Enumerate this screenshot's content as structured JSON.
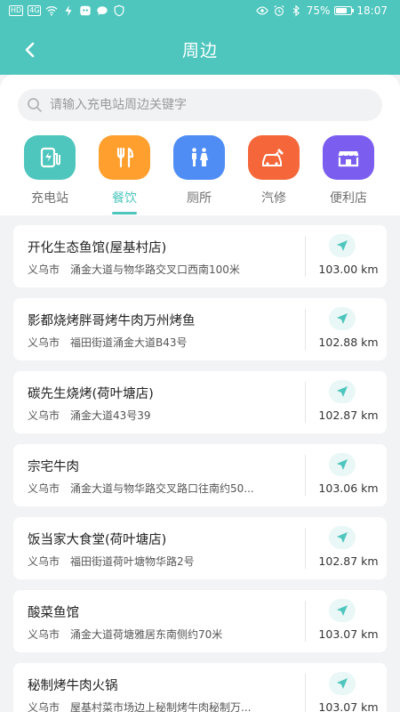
{
  "status_bar": {
    "hd": "HD",
    "net": "4G",
    "battery_pct": "75%",
    "battery_level": 0.75,
    "time": "18:07"
  },
  "header": {
    "title": "周边",
    "back_icon": "chevron-left-icon"
  },
  "search": {
    "placeholder": "请输入充电站周边关键字",
    "value": ""
  },
  "colors": {
    "brand": "#4ec6bd",
    "charging": "#4ec6bd",
    "food": "#ff9f2e",
    "toilet": "#4f8df5",
    "repair": "#f5673a",
    "store": "#7b5ef0"
  },
  "categories": [
    {
      "label": "充电站",
      "icon": "charging-station-icon",
      "color": "#4ec6bd",
      "active": false
    },
    {
      "label": "餐饮",
      "icon": "fork-knife-icon",
      "color": "#ff9f2e",
      "active": true
    },
    {
      "label": "厕所",
      "icon": "toilet-icon",
      "color": "#4f8df5",
      "active": false
    },
    {
      "label": "汽修",
      "icon": "car-repair-icon",
      "color": "#f5673a",
      "active": false
    },
    {
      "label": "便利店",
      "icon": "store-icon",
      "color": "#7b5ef0",
      "active": false
    }
  ],
  "places": [
    {
      "name": "开化生态鱼馆(屋基村店)",
      "city": "义乌市",
      "address": "涌金大道与物华路交叉口西南100米",
      "distance": "103.00 km"
    },
    {
      "name": "影都烧烤胖哥烤牛肉万州烤鱼",
      "city": "义乌市",
      "address": "福田街道涌金大道B43号",
      "distance": "102.88 km"
    },
    {
      "name": "碳先生烧烤(荷叶塘店)",
      "city": "义乌市",
      "address": "涌金大道43号39",
      "distance": "102.87 km"
    },
    {
      "name": "宗宅牛肉",
      "city": "义乌市",
      "address": "涌金大道与物华路交叉路口往南约50...",
      "distance": "103.06 km"
    },
    {
      "name": "饭当家大食堂(荷叶塘店)",
      "city": "义乌市",
      "address": "福田街道荷叶塘物华路2号",
      "distance": "102.87 km"
    },
    {
      "name": "酸菜鱼馆",
      "city": "义乌市",
      "address": "涌金大道荷塘雅居东南侧约70米",
      "distance": "103.07 km"
    },
    {
      "name": "秘制烤牛肉火锅",
      "city": "义乌市",
      "address": "屋基村菜市场边上秘制烤牛肉秘制万...",
      "distance": "103.07 km"
    }
  ]
}
